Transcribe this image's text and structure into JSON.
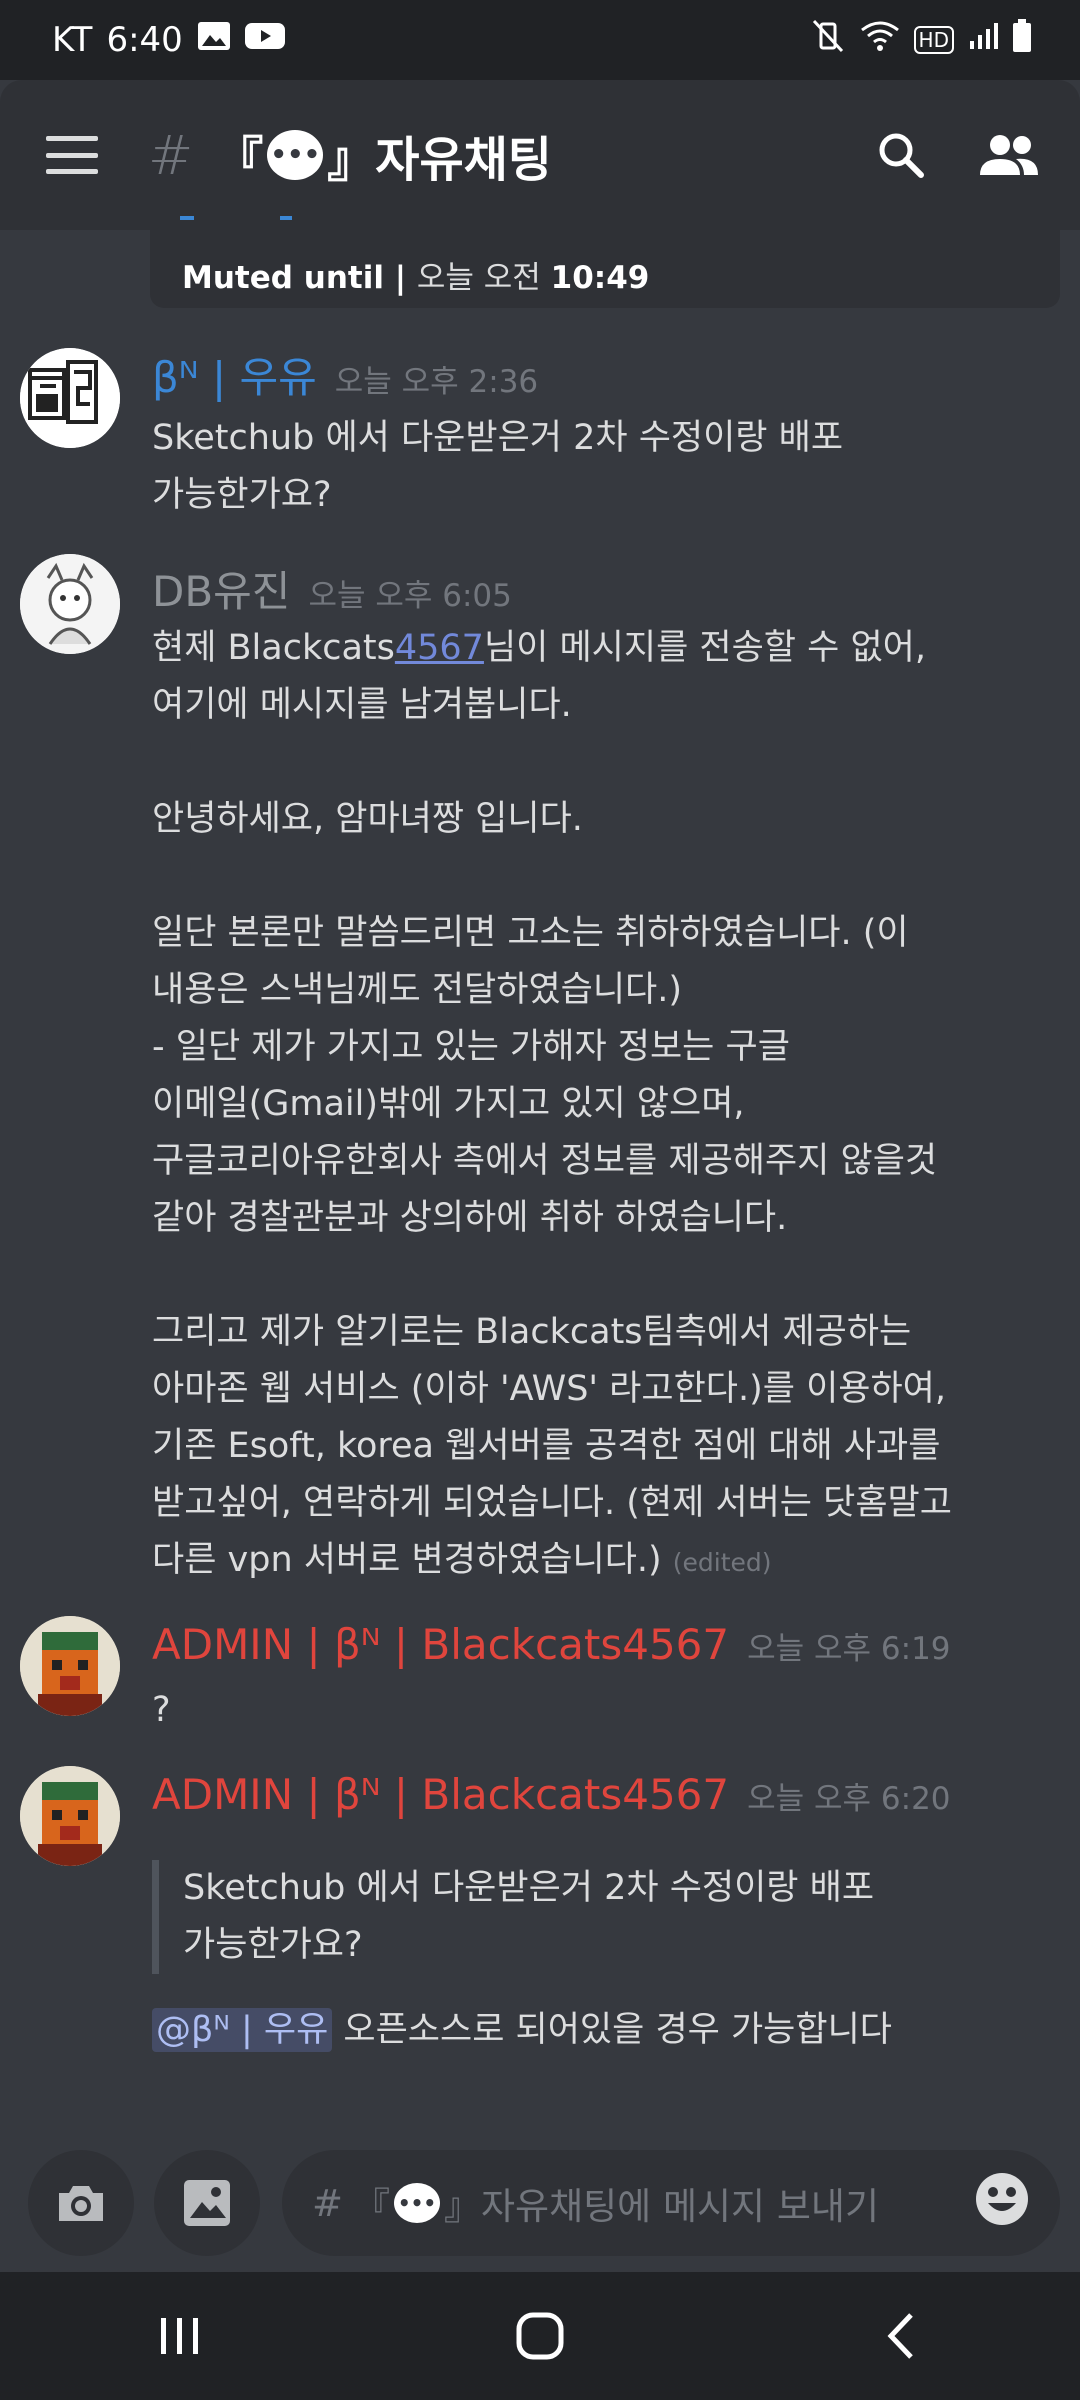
{
  "status_bar": {
    "carrier": "KT",
    "time": "6:40",
    "hd_badge": "HD"
  },
  "header": {
    "hash": "#",
    "bracket_open": "『",
    "bubble_emoji": "•••",
    "bracket_close": "』",
    "channel_name": "자유채팅",
    "search_icon": "search-icon",
    "members_icon": "members-icon"
  },
  "muted_notice": {
    "label": "Muted until | ",
    "date": "오늘 오전 ",
    "time": "10:49"
  },
  "messages": [
    {
      "username": "βᴺ | 우유",
      "username_color": "#3b87d6",
      "timestamp": "오늘 오후 2:36",
      "text": "Sketchub 에서 다운받은거 2차 수정이랑 배포\n가능한가요?"
    },
    {
      "username": "DB유진",
      "username_color": "#8e9297",
      "timestamp": "오늘 오후 6:05",
      "text_before_link": "현제 Blackcats",
      "link_text": "4567",
      "text_after_link": "님이 메시지를 전송할 수 없어,\n여기에 메시지를 남겨봅니다.\n\n안녕하세요, 암마녀짱 입니다.\n\n일단 본론만 말씀드리면 고소는 취하하였습니다. (이\n내용은 스낵님께도 전달하였습니다.)\n- 일단 제가 가지고 있는 가해자 정보는 구글\n이메일(Gmail)밖에 가지고 있지 않으며,\n구글코리아유한회사 측에서 정보를 제공해주지 않을것\n같아 경찰관분과 상의하에 취하 하였습니다.\n\n그리고 제가 알기로는 Blackcats팀측에서 제공하는\n아마존 웹 서비스 (이하 'AWS' 라고한다.)를 이용하여,\n기존 Esoft, korea 웹서버를 공격한 점에 대해 사과를\n받고싶어, 연락하게 되었습니다. (현제 서버는 닷홈말고\n다른 vpn 서버로 변경하였습니다.) ",
      "edited": "(edited)"
    },
    {
      "username": "ADMIN | βᴺ | Blackcats4567",
      "username_color": "#e0453d",
      "timestamp": "오늘 오후 6:19",
      "text": "?"
    },
    {
      "username": "ADMIN | βᴺ | Blackcats4567",
      "username_color": "#e0453d",
      "timestamp": "오늘 오후 6:20",
      "quote": "Sketchub 에서 다운받은거 2차 수정이랑 배포\n가능한가요?",
      "mention": "@βᴺ | 우유",
      "reply": " 오픈소스로 되어있을 경우 가능합니다"
    }
  ],
  "composer": {
    "hash": "#",
    "bracket_open": "『",
    "bubble_emoji": "•••",
    "placeholder_rest": "』자유채팅에 메시지 보내기",
    "camera_icon": "camera-icon",
    "image_icon": "image-icon",
    "emoji_icon": "emoji-icon"
  },
  "nav": {
    "recents_icon": "recents-icon",
    "home_icon": "home-icon",
    "back_icon": "back-icon"
  }
}
